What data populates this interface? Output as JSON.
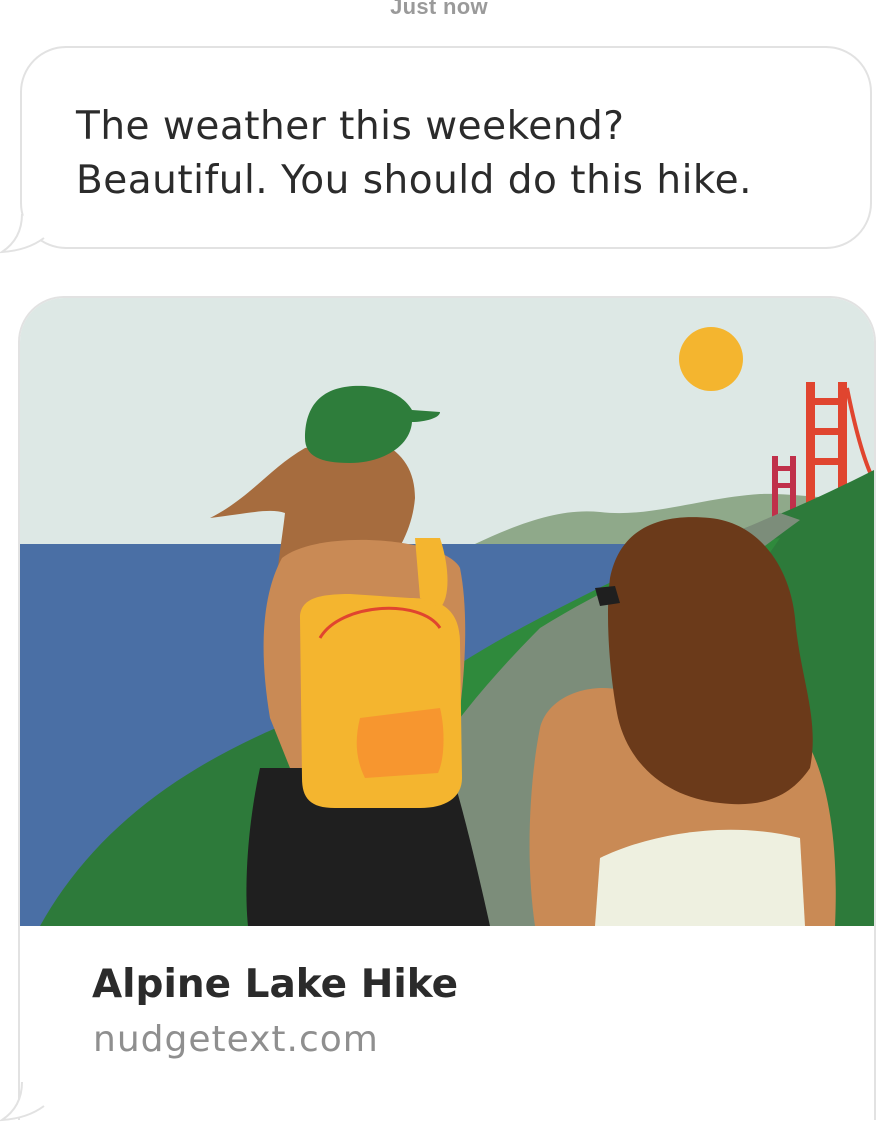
{
  "timestamp": "Just now",
  "message": {
    "lines": [
      "The weather this weekend?",
      "Beautiful. You should do this hike."
    ]
  },
  "link_preview": {
    "title": "Alpine Lake Hike",
    "domain": "nudgetext.com",
    "image": "illustration-two-hikers-coast-bridge"
  },
  "colors": {
    "text": "#2b2b2b",
    "subtle_text": "#8f8f8f",
    "bubble_border": "#e2e2e2",
    "sky": "#dde8e5",
    "sea": "#4a6fa5",
    "hill": "#2d7a3a",
    "bridge": "#e0452f",
    "sun": "#f4b52f"
  }
}
